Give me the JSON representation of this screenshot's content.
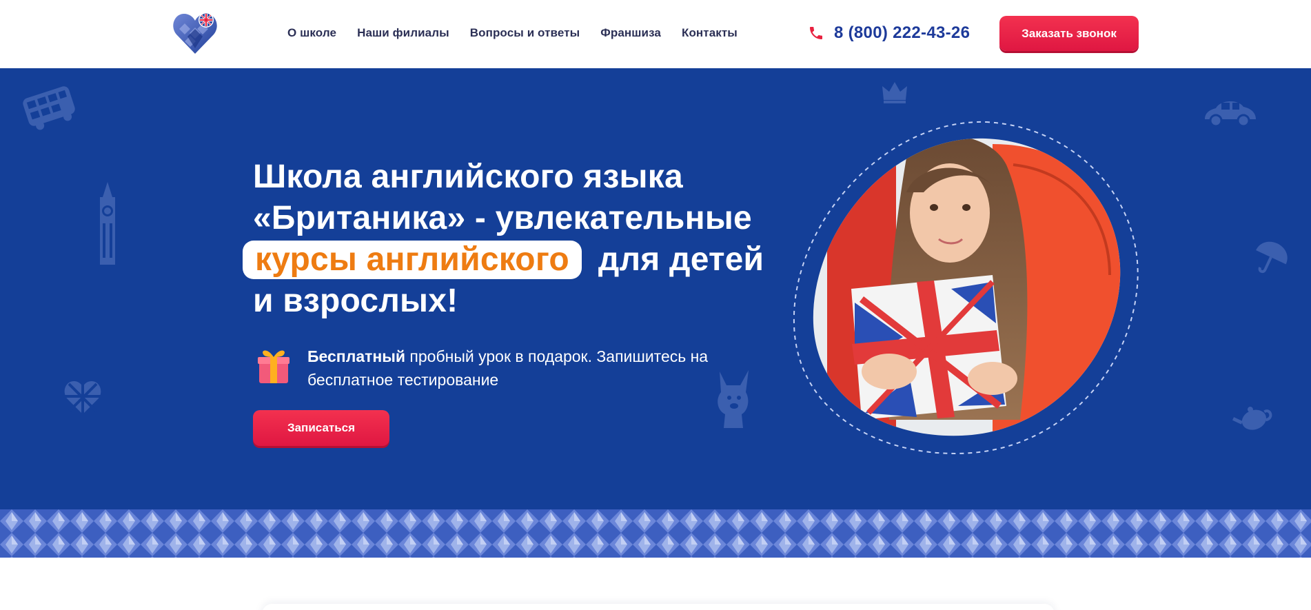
{
  "header": {
    "logo_name": "britannica-heart-logo",
    "nav": [
      {
        "label": "О школе"
      },
      {
        "label": "Наши филиалы"
      },
      {
        "label": "Вопросы и ответы"
      },
      {
        "label": "Франшиза"
      },
      {
        "label": "Контакты"
      }
    ],
    "phone": "8 (800) 222-43-26",
    "callback_label": "Заказать звонок"
  },
  "hero": {
    "title_part1": "Школа английского языка «Британика» - увлекательные",
    "title_highlight": "курсы английского",
    "title_part2": "для детей и взрослых!",
    "promo_bold": "Бесплатный",
    "promo_rest": " пробный урок в подарок. Запишитесь на бесплатное тестирование",
    "signup_label": "Записаться",
    "decorations": [
      "bus-icon",
      "big-ben-icon",
      "union-jack-heart-icon",
      "crown-icon",
      "car-icon",
      "umbrella-icon",
      "teapot-icon",
      "bulldog-icon"
    ]
  },
  "colors": {
    "brand_blue": "#143f98",
    "accent_red": "#e8213f",
    "highlight_orange": "#ee7c12",
    "nav_text": "#2b2f55",
    "phone_blue": "#1d3a9a"
  }
}
